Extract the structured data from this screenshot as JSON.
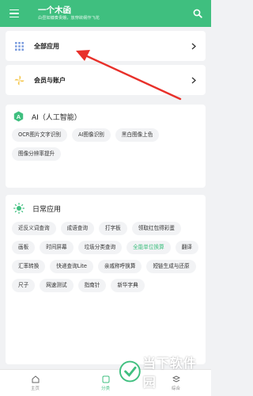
{
  "header": {
    "title": "一个木函",
    "subtitle": "白昼如镰奏贵娥，放穿欲纲作飞花",
    "bg_color": "#3fbf7f"
  },
  "menu": [
    {
      "label": "全部应用",
      "icon": "grid-icon"
    },
    {
      "label": "会员与账户",
      "icon": "pinwheel-icon"
    }
  ],
  "ai": {
    "title": "AI（人工智能）",
    "chips": [
      "OCR图片文字识别",
      "AI图像识别",
      "黑白图像上色",
      "图像分辨率提升"
    ]
  },
  "daily": {
    "title": "日常应用",
    "chips": [
      "近反义词查询",
      "成语查询",
      "打字板",
      "领取红包得彩蛋",
      "画板",
      "时间屏幕",
      "垃圾分类查询",
      "全能单位换算",
      "翻译",
      "汇率转换",
      "快递查询Lite",
      "亲戚称呼换算",
      "短链生成与还原",
      "尺子",
      "网速测试",
      "指南针",
      "新华字典"
    ]
  },
  "bottom_tabs": [
    {
      "label": "主页"
    },
    {
      "label": "分类"
    },
    {
      "label": "综合"
    }
  ],
  "watermark": {
    "text": "当下软件园"
  },
  "colors": {
    "accent": "#3fbf7f",
    "arrow": "#e8302a"
  }
}
